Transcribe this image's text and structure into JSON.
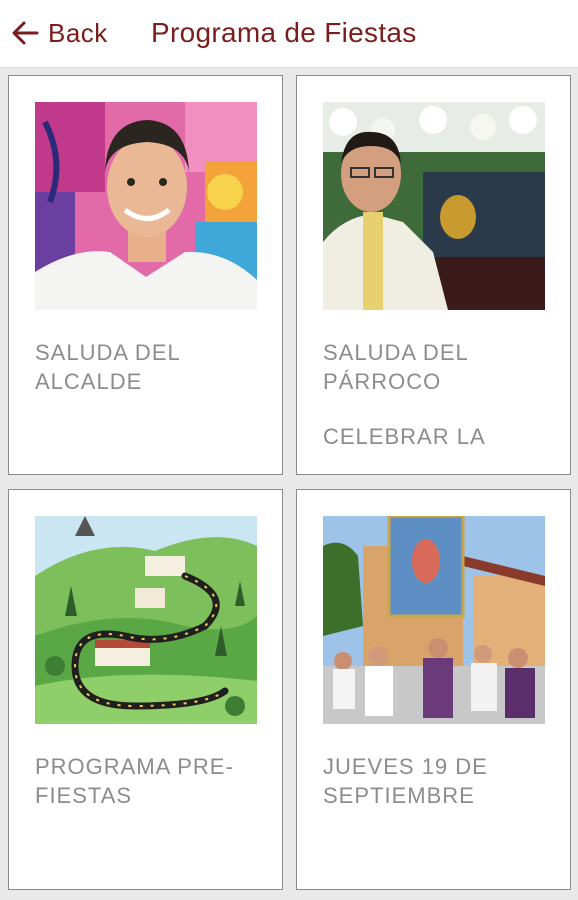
{
  "header": {
    "back_label": "Back",
    "title": "Programa de Fiestas",
    "accent_color": "#7b1d1d"
  },
  "cards": [
    {
      "title": "SALUDA DEL ALCALDE",
      "subtitle": "",
      "image": "mayor-portrait-photo"
    },
    {
      "title": "SALUDA DEL PÁRROCO",
      "subtitle": "CELEBRAR LA",
      "image": "priest-portrait-photo"
    },
    {
      "title": "PROGRAMA PRE-FIESTAS",
      "subtitle": "",
      "image": "town-map-illustration"
    },
    {
      "title": "JUEVES 19 DE SEPTIEMBRE",
      "subtitle": "",
      "image": "procession-photo"
    }
  ]
}
